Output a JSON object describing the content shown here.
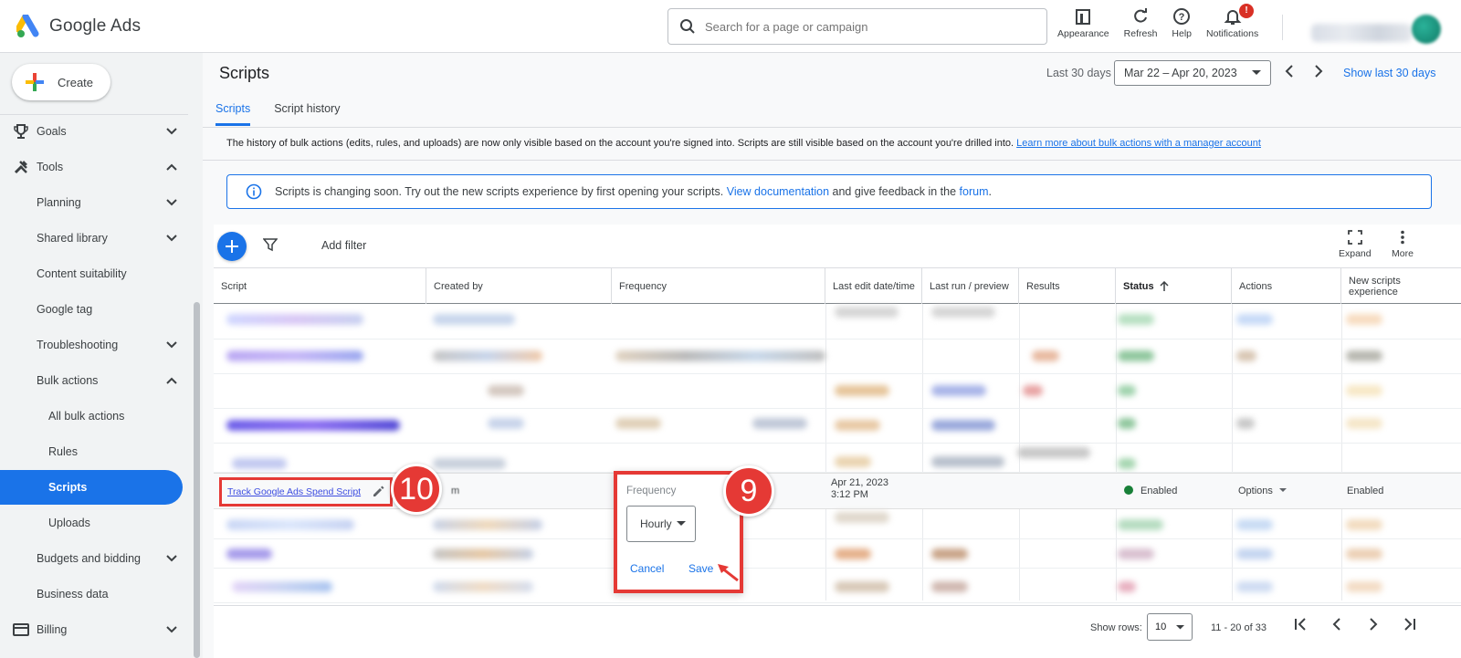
{
  "app": {
    "name": "Google Ads"
  },
  "search": {
    "placeholder": "Search for a page or campaign"
  },
  "top_actions": [
    {
      "label": "Appearance",
      "icon": "appearance-icon"
    },
    {
      "label": "Refresh",
      "icon": "refresh-icon"
    },
    {
      "label": "Help",
      "icon": "help-icon"
    },
    {
      "label": "Notifications",
      "icon": "bell-icon",
      "badge": "!"
    }
  ],
  "sidebar": {
    "create_label": "Create",
    "items": [
      {
        "label": "Goals",
        "icon": "trophy-icon",
        "chevron": "down"
      },
      {
        "label": "Tools",
        "icon": "tools-icon",
        "chevron": "up"
      },
      {
        "label": "Planning",
        "chevron": "down"
      },
      {
        "label": "Shared library",
        "chevron": "down"
      },
      {
        "label": "Content suitability"
      },
      {
        "label": "Google tag"
      },
      {
        "label": "Troubleshooting",
        "chevron": "down"
      },
      {
        "label": "Bulk actions",
        "chevron": "up"
      },
      {
        "label": "All bulk actions"
      },
      {
        "label": "Rules"
      },
      {
        "label": "Scripts",
        "active": true
      },
      {
        "label": "Uploads"
      },
      {
        "label": "Budgets and bidding",
        "chevron": "down"
      },
      {
        "label": "Business data"
      },
      {
        "label": "Billing",
        "icon": "card-icon",
        "chevron": "down"
      }
    ]
  },
  "header": {
    "title": "Scripts",
    "date_label": "Last 30 days",
    "date_range": "Mar 22 – Apr 20, 2023",
    "show_last": "Show last 30 days"
  },
  "tabs": [
    {
      "label": "Scripts",
      "active": true
    },
    {
      "label": "Script history"
    }
  ],
  "history_note": {
    "text": "The history of bulk actions (edits, rules, and uploads) are now only visible based on the account you're signed into. Scripts are still visible based on the account you're drilled into.",
    "link": "Learn more about bulk actions with a manager account"
  },
  "banner": {
    "text_before": "Scripts is changing soon. Try out the new scripts experience by first opening your scripts.",
    "link1": "View documentation",
    "text_mid": "and give feedback in the",
    "link2": "forum",
    "text_end": "."
  },
  "toolbar": {
    "add_filter": "Add filter",
    "expand": "Expand",
    "more": "More"
  },
  "table": {
    "columns": [
      "Script",
      "Created by",
      "Frequency",
      "Last edit date/time",
      "Last run / preview",
      "Results",
      "Status",
      "Actions"
    ],
    "last_column": {
      "line1": "New scripts",
      "line2": "experience"
    },
    "focus_row": {
      "script": "Track Google Ads Spend Script",
      "created_by": "m",
      "last_edit_date": "Apr 21, 2023",
      "last_edit_time": "3:12 PM",
      "status": "Enabled",
      "actions": "Options",
      "new_experience": "Enabled"
    }
  },
  "frequency_popup": {
    "label": "Frequency",
    "value": "Hourly",
    "cancel": "Cancel",
    "save": "Save"
  },
  "annotations": {
    "step_a": "10",
    "step_b": "9"
  },
  "footer": {
    "show_rows_label": "Show rows:",
    "rows_value": "10",
    "range": "11 - 20 of 33"
  },
  "colors": {
    "accent": "#1a73e8",
    "highlight": "#e53935",
    "status_green": "#188038"
  }
}
